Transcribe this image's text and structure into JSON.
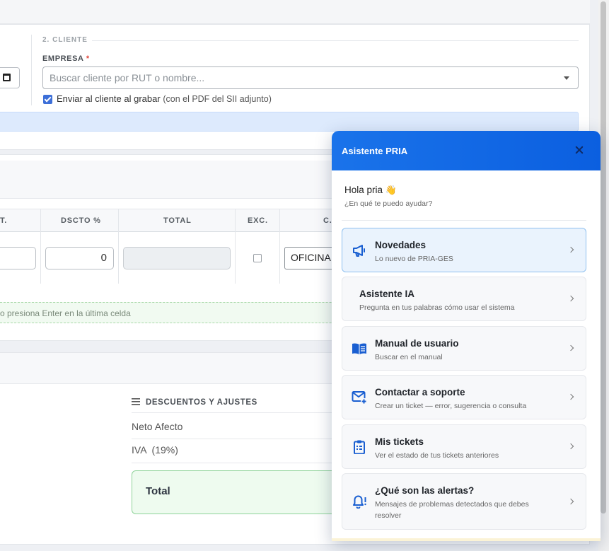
{
  "form": {
    "section_title": "2. CLIENTE",
    "empresa_label": "EMPRESA",
    "required_mark": "*",
    "client_placeholder": "Buscar cliente por RUT o nombre...",
    "send_label": "Enviar al cliente al grabar",
    "send_sub": "(con el PDF del SII adjunto)",
    "send_checked": true
  },
  "table": {
    "headers": {
      "cant": "T.",
      "dscto": "DSCTO %",
      "total": "TOTAL",
      "exc": "EXC.",
      "c": "C."
    },
    "row": {
      "dscto_value": "0",
      "total_value": "",
      "exc_checked": false,
      "cost_center": "OFICINA"
    },
    "hint": "o presiona Enter en la última celda"
  },
  "summary": {
    "title": "DESCUENTOS Y AJUSTES",
    "neto_label": "Neto Afecto",
    "iva_label": "IVA  (19%)",
    "total_label": "Total"
  },
  "assistant": {
    "title": "Asistente PRIA",
    "greeting": "Hola pria",
    "greeting_emoji": "👋",
    "subtitle": "¿En qué te puedo ayudar?",
    "options": [
      {
        "title": "Novedades",
        "subtitle": "Lo nuevo de PRIA-GES",
        "icon": "megaphone-icon"
      },
      {
        "title": "Asistente IA",
        "subtitle": "Pregunta en tus palabras cómo usar el sistema",
        "icon": ""
      },
      {
        "title": "Manual de usuario",
        "subtitle": "Buscar en el manual",
        "icon": "book-icon"
      },
      {
        "title": "Contactar a soporte",
        "subtitle": "Crear un ticket — error, sugerencia o consulta",
        "icon": "mail-plus-icon"
      },
      {
        "title": "Mis tickets",
        "subtitle": "Ver el estado de tus tickets anteriores",
        "icon": "clipboard-list-icon"
      },
      {
        "title": "¿Qué son las alertas?",
        "subtitle": "Mensajes de problemas detectados que debes resolver",
        "icon": "bell-alert-icon"
      }
    ]
  },
  "colors": {
    "accent": "#1a73ea",
    "icon_blue": "#1a5fd1",
    "required": "#e0453a",
    "checkbox": "#3d6fd8"
  }
}
